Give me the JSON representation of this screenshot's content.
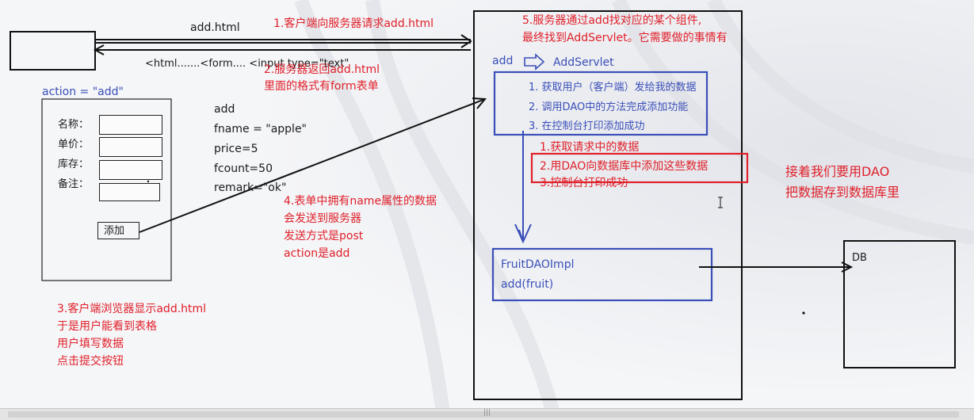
{
  "client_panel": {
    "action_label": "action = \"add\"",
    "fields": [
      {
        "label": "名称："
      },
      {
        "label": "单价："
      },
      {
        "label": "库存："
      },
      {
        "label": "备注："
      }
    ],
    "submit_label": "添加"
  },
  "request": {
    "url_label": "add.html",
    "html_snippet": "<html.......<form.... <input type=\"text\""
  },
  "notes": {
    "step1": "1.客户端向服务器请求add.html",
    "step2_line1": "2.服务器返回add.html",
    "step2_line2": "里面的格式有form表单",
    "step3_lines": [
      "3.客户端浏览器显示add.html",
      "于是用户能看到表格",
      "用户填写数据",
      "点击提交按钮"
    ],
    "step4_lines": [
      "4.表单中拥有name属性的数据",
      "会发送到服务器",
      "发送方式是post",
      "action是add"
    ],
    "step5_line1": "5.服务器通过add找对应的某个组件,",
    "step5_line2": "最终找到AddServlet。它需要做的事情有",
    "right_note_line1": "接着我们要用DAO",
    "right_note_line2": "把数据存到数据库里"
  },
  "form_data": [
    "add",
    "fname = \"apple\"",
    "price=5",
    "fcount=50",
    "remark=\"ok\""
  ],
  "server": {
    "mapping_from": "add",
    "mapping_to": "AddServlet",
    "servlet_steps": [
      "1. 获取用户（客户端）发给我的数据",
      "2. 调用DAO中的方法完成添加功能",
      "3. 在控制台打印添加成功"
    ],
    "red_steps": [
      "1.获取请求中的数据",
      "2.用DAO向数据库中添加这些数据",
      "3.控制台打印成功"
    ],
    "dao_class": "FruitDAOImpl",
    "dao_method": "add(fruit)"
  },
  "db_label": "DB",
  "scroll_grip": "|||",
  "colors": {
    "red": "#e0202a",
    "blue": "#3a4fb8",
    "black": "#1a1a1a"
  }
}
